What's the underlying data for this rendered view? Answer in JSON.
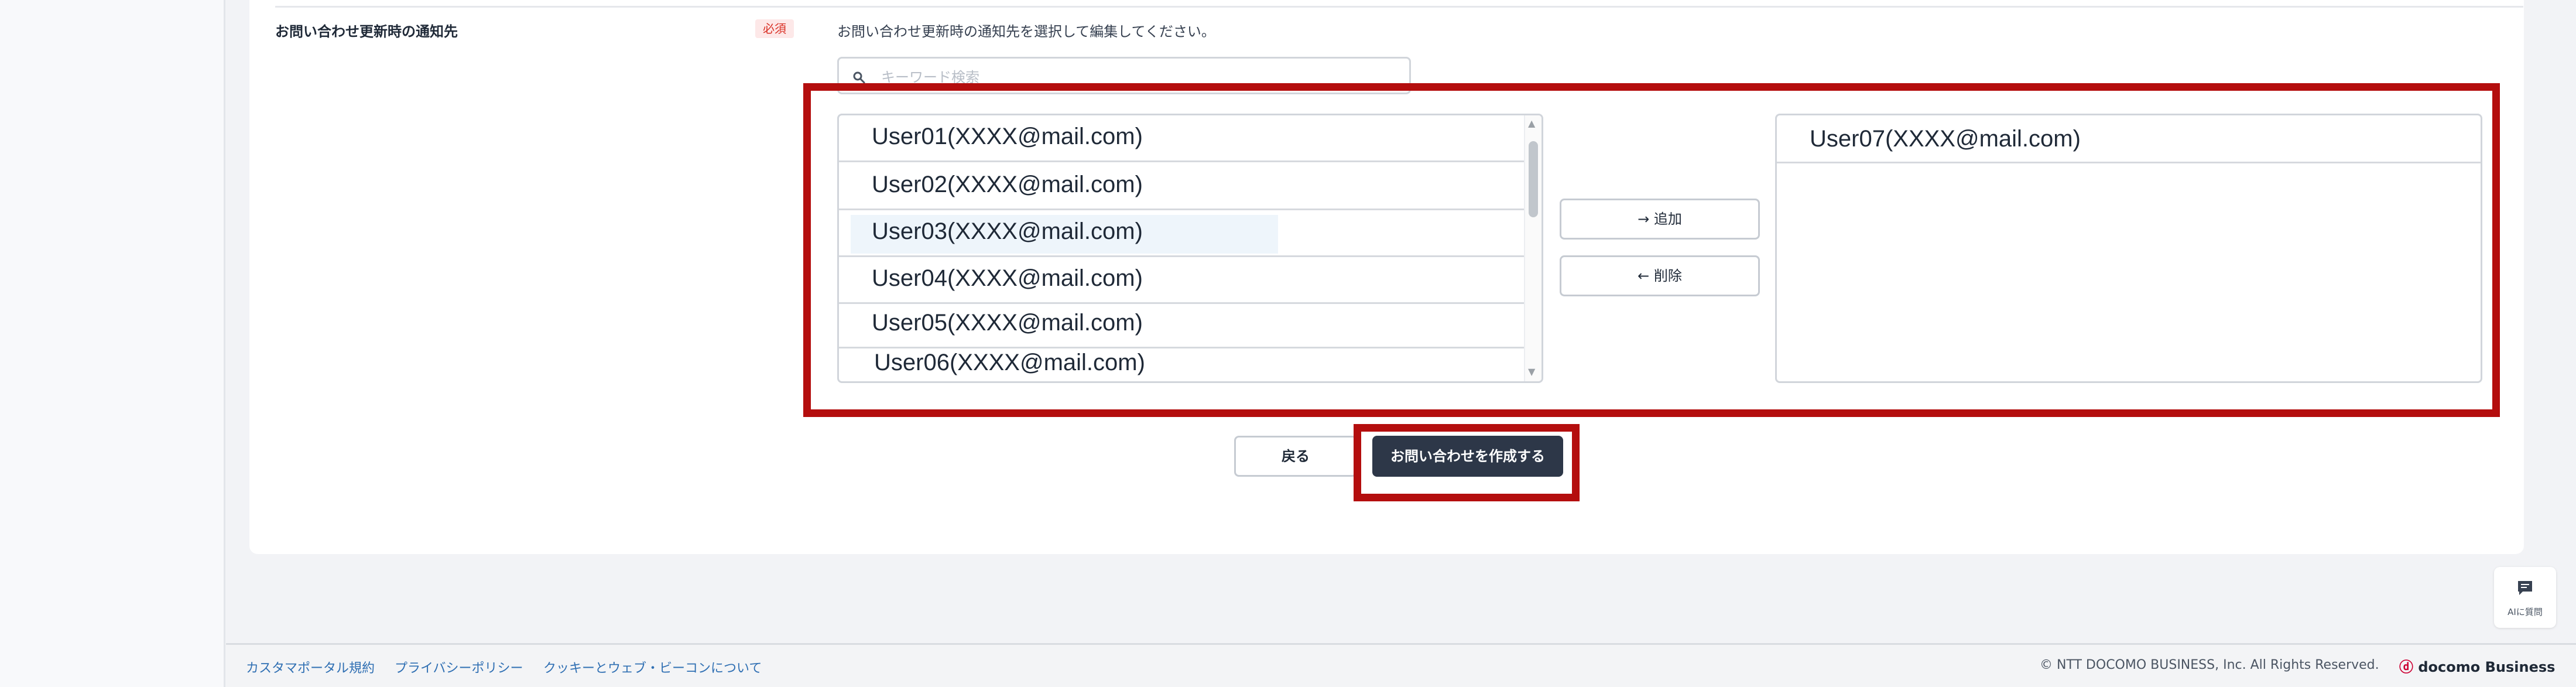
{
  "form": {
    "field_label": "お問い合わせ更新時の通知先",
    "required_badge": "必須",
    "help_text": "お問い合わせ更新時の通知先を選択して編集してください。",
    "search_placeholder": "キーワード検索"
  },
  "available_users": [
    "User01(XXXX@mail.com)",
    "User02(XXXX@mail.com)",
    "User03(XXXX@mail.com)",
    "User04(XXXX@mail.com)",
    "User05(XXXX@mail.com)",
    "User06(XXXX@mail.com)"
  ],
  "selected_users": [
    "User07(XXXX@mail.com)"
  ],
  "buttons": {
    "add": "→ 追加",
    "remove": "← 削除",
    "back": "戻る",
    "submit": "お問い合わせを作成する"
  },
  "ai_help": {
    "label": "AIに質問"
  },
  "footer": {
    "links": [
      "カスタマポータル規約",
      "プライバシーポリシー",
      "クッキーとウェブ・ビーコンについて"
    ],
    "copyright": "© NTT DOCOMO BUSINESS, Inc. All Rights Reserved.",
    "brand_mark": "ⓓ",
    "brand_name": "docomo Business"
  },
  "colors": {
    "highlight": "#b40e0e",
    "primary_button": "#2d3748",
    "required": "#d93025",
    "link": "#2f6fb3"
  },
  "icons": {
    "search": "search-icon",
    "ai_chat": "chat-icon"
  }
}
